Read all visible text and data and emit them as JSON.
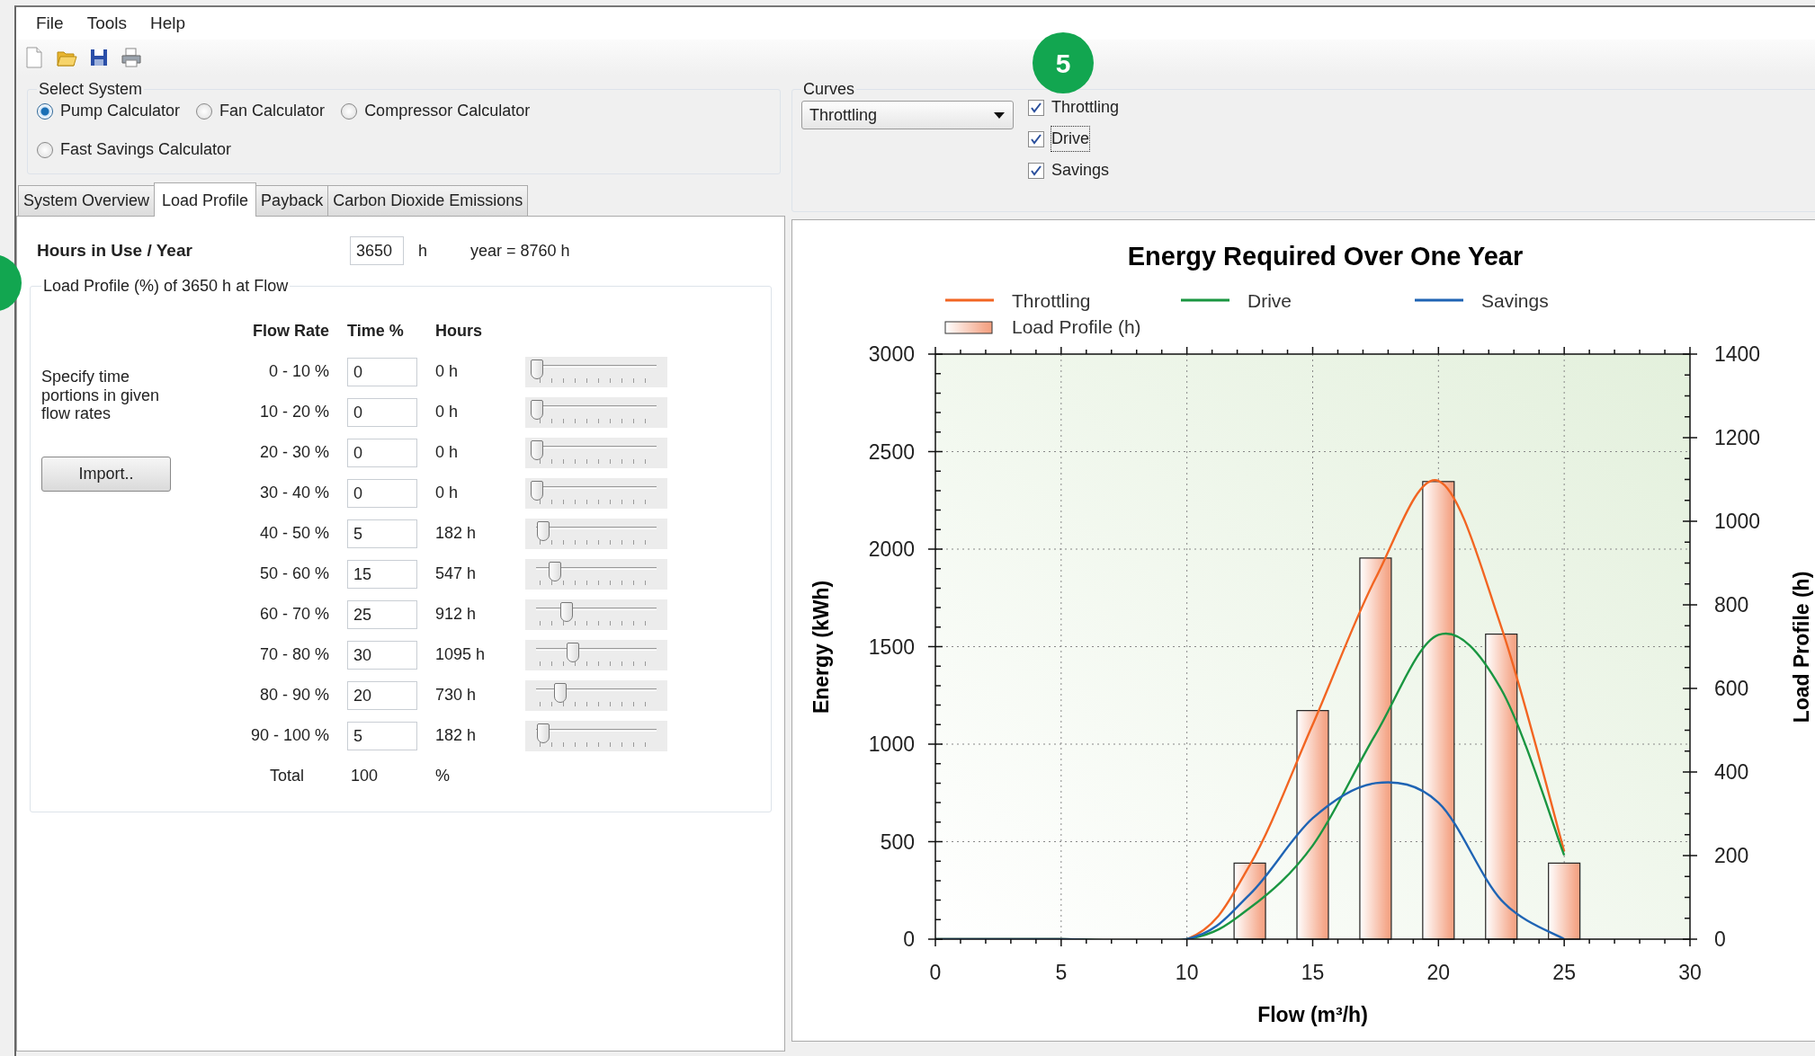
{
  "menu": [
    "File",
    "Tools",
    "Help"
  ],
  "step_badge": "5",
  "select_system": {
    "title": "Select System",
    "options": [
      {
        "label": "Pump Calculator",
        "selected": true
      },
      {
        "label": "Fan Calculator",
        "selected": false
      },
      {
        "label": "Compressor Calculator",
        "selected": false
      },
      {
        "label": "Fast Savings Calculator",
        "selected": false
      }
    ]
  },
  "tabs": [
    {
      "label": "System Overview",
      "selected": false
    },
    {
      "label": "Load Profile",
      "selected": true
    },
    {
      "label": "Payback",
      "selected": false
    },
    {
      "label": "Carbon Dioxide Emissions",
      "selected": false
    }
  ],
  "load_profile": {
    "hours_label": "Hours in Use / Year",
    "hours_value": "3650",
    "hours_unit": "h",
    "year_note": "year = 8760 h",
    "group_title": "Load Profile (%) of 3650 h at Flow",
    "columns": [
      "Flow Rate",
      "Time %",
      "Hours"
    ],
    "hint": "Specify time portions in given flow rates",
    "import_button": "Import..",
    "rows": [
      {
        "flow": "0 - 10 %",
        "time": "0",
        "hours": "0 h",
        "level": 0
      },
      {
        "flow": "10 - 20 %",
        "time": "0",
        "hours": "0 h",
        "level": 0
      },
      {
        "flow": "20 - 30 %",
        "time": "0",
        "hours": "0 h",
        "level": 0
      },
      {
        "flow": "30 - 40 %",
        "time": "0",
        "hours": "0 h",
        "level": 0
      },
      {
        "flow": "40 - 50 %",
        "time": "5",
        "hours": "182 h",
        "level": 0.05
      },
      {
        "flow": "50 - 60 %",
        "time": "15",
        "hours": "547 h",
        "level": 0.15
      },
      {
        "flow": "60 - 70 %",
        "time": "25",
        "hours": "912 h",
        "level": 0.25
      },
      {
        "flow": "70 - 80 %",
        "time": "30",
        "hours": "1095 h",
        "level": 0.3
      },
      {
        "flow": "80 - 90 %",
        "time": "20",
        "hours": "730 h",
        "level": 0.2
      },
      {
        "flow": "90 - 100 %",
        "time": "5",
        "hours": "182 h",
        "level": 0.05
      }
    ],
    "total_label": "Total",
    "total_value": "100",
    "total_unit": "%"
  },
  "curves": {
    "title": "Curves",
    "dropdown": "Throttling",
    "checks": [
      {
        "label": "Throttling",
        "checked": true,
        "focused": false
      },
      {
        "label": "Drive",
        "checked": true,
        "focused": true
      },
      {
        "label": "Savings",
        "checked": true,
        "focused": false
      }
    ]
  },
  "chart": {
    "chart_data": {
      "type": "line",
      "title": "Energy Required Over One Year",
      "xlabel": "Flow (m³/h)",
      "ylabel": "Energy (kWh)",
      "y2label": "Load Profile (h)",
      "x": [
        0,
        5,
        10,
        12.5,
        15,
        17.5,
        20,
        22.5,
        25
      ],
      "series": [
        {
          "name": "Throttling",
          "color": "#f26522",
          "values": [
            0,
            0,
            0,
            380,
            1100,
            1850,
            2350,
            1600,
            450
          ]
        },
        {
          "name": "Drive",
          "color": "#1a9641",
          "values": [
            0,
            0,
            0,
            160,
            480,
            1050,
            1560,
            1280,
            430
          ]
        },
        {
          "name": "Savings",
          "color": "#1f64b4",
          "values": [
            0,
            0,
            0,
            230,
            620,
            800,
            700,
            200,
            0
          ]
        },
        {
          "name": "Load Profile (h)",
          "color": "#f4a080",
          "type": "bar",
          "axis": "y2",
          "values": [
            null,
            null,
            null,
            182,
            547,
            912,
            1095,
            730,
            182
          ]
        }
      ],
      "grid": true,
      "legend": "top",
      "xlim": [
        0,
        30
      ],
      "ylim": [
        0,
        3000
      ],
      "y2lim": [
        0,
        1400
      ],
      "xticks": [
        0,
        5,
        10,
        15,
        20,
        25,
        30
      ],
      "yticks": [
        0,
        500,
        1000,
        1500,
        2000,
        2500,
        3000
      ],
      "y2ticks": [
        0,
        200,
        400,
        600,
        800,
        1000,
        1200,
        1400
      ]
    }
  }
}
